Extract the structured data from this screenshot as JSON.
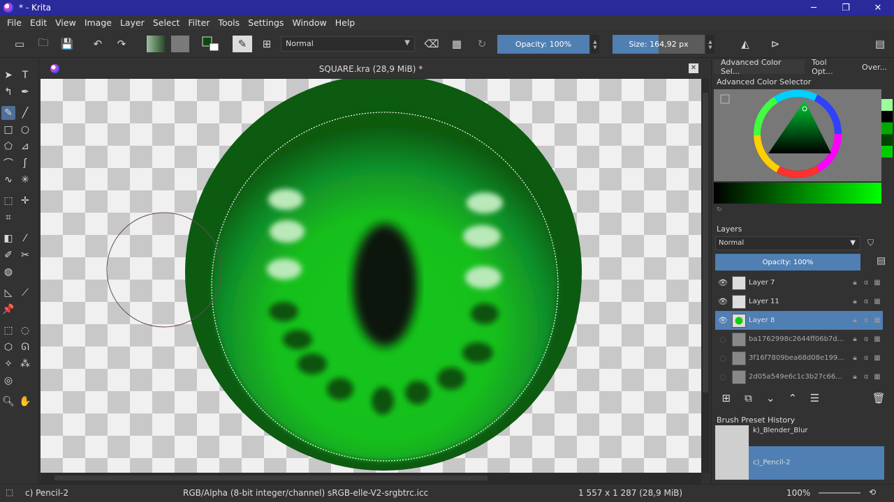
{
  "window": {
    "title": "* - Krita",
    "min": "─",
    "max": "❐",
    "close": "✕"
  },
  "menu": [
    "File",
    "Edit",
    "View",
    "Image",
    "Layer",
    "Select",
    "Filter",
    "Tools",
    "Settings",
    "Window",
    "Help"
  ],
  "toolbar": {
    "blend_mode": "Normal",
    "opacity_label": "Opacity: 100%",
    "size_label": "Size: 164,92 px",
    "opacity": 1.0
  },
  "document": {
    "title": "SQUARE.kra (28,9 MiB) *"
  },
  "dock": {
    "tabs": [
      "Advanced Color Sel...",
      "Tool Opt...",
      "Over..."
    ],
    "color_selector_title": "Advanced Color Selector",
    "layers_title": "Layers",
    "layers_blend": "Normal",
    "layers_opacity": "Opacity:  100%",
    "layers": [
      {
        "name": "Layer 7",
        "visible": true,
        "selected": false
      },
      {
        "name": "Layer 11",
        "visible": true,
        "selected": false
      },
      {
        "name": "Layer 8",
        "visible": true,
        "selected": true
      },
      {
        "name": "ba1762998c2644ff06b7d...",
        "visible": false,
        "selected": false
      },
      {
        "name": "3f16f7809bea68d08e199...",
        "visible": false,
        "selected": false
      },
      {
        "name": "2d05a549e6c1c3b27c66...",
        "visible": false,
        "selected": false
      }
    ],
    "brush_history_title": "Brush Preset History",
    "brushes": [
      "k)_Blender_Blur",
      "c)_Pencil-2"
    ]
  },
  "status": {
    "brush": "c) Pencil-2",
    "color_space": "RGB/Alpha (8-bit integer/channel)  sRGB-elle-V2-srgbtrc.icc",
    "dimensions": "1 557 x 1 287 (28,9 MiB)",
    "zoom": "100%"
  },
  "colors": {
    "accent": "#4f7fb3",
    "titlebar": "#2a2a9a",
    "eye_dark": "#0f4d12",
    "eye_bright": "#12d01f"
  }
}
